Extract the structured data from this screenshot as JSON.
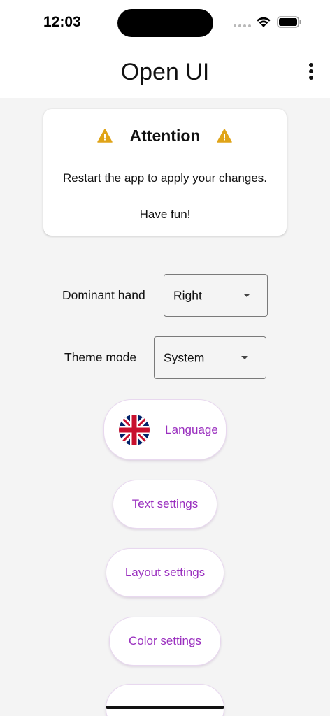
{
  "status_bar": {
    "time": "12:03"
  },
  "app_bar": {
    "title": "Open UI",
    "menu_icon": "more-vert-icon"
  },
  "notice": {
    "title": "Attention",
    "icon": "warning-icon",
    "icon_color": "#e0a418",
    "message": "Restart the app to apply your changes.",
    "footer": "Have fun!"
  },
  "settings": {
    "dominant_hand": {
      "label": "Dominant hand",
      "value": "Right"
    },
    "theme_mode": {
      "label": "Theme mode",
      "value": "System"
    }
  },
  "buttons": {
    "language": "Language",
    "text_settings": "Text settings",
    "layout_settings": "Layout settings",
    "color_settings": "Color settings"
  },
  "colors": {
    "accent": "#9a2fbf",
    "background": "#f4f4f4"
  }
}
